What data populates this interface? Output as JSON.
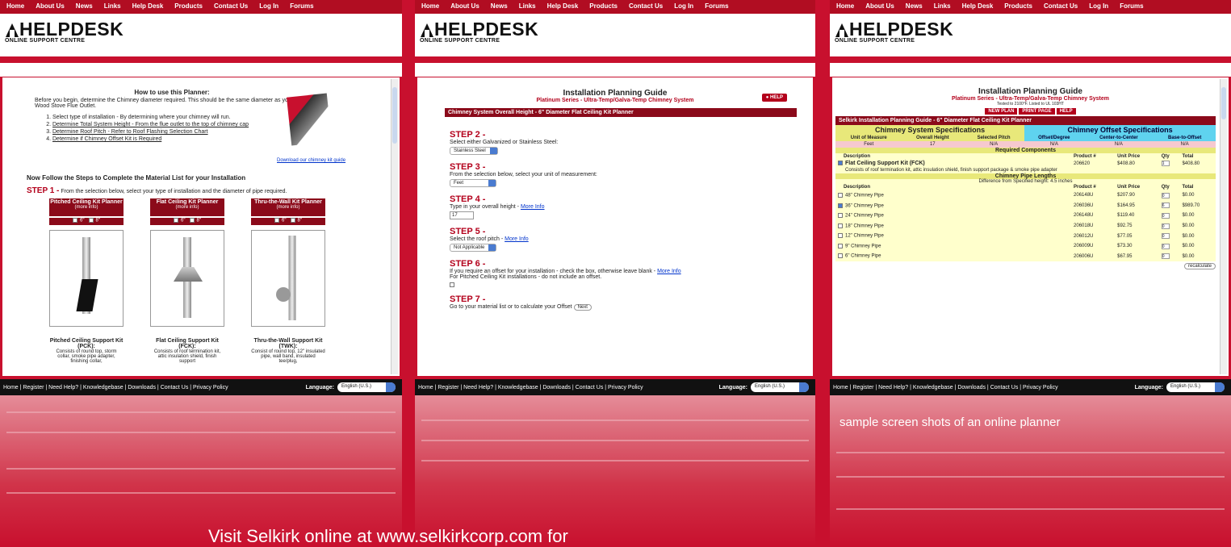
{
  "nav": [
    "Home",
    "About Us",
    "News",
    "Links",
    "Help Desk",
    "Products",
    "Contact Us",
    "Log In",
    "Forums"
  ],
  "logo": {
    "title": "HELPDESK",
    "subtitle": "ONLINE SUPPORT CENTRE"
  },
  "footer": {
    "links": "Home  |  Register  |  Need Help?  |  Knowledgebase  |  Downloads  |  Contact Us  |  Privacy Policy",
    "language_label": "Language:",
    "language_value": "English (U.S.)"
  },
  "panel1": {
    "title": "How to use this Planner:",
    "intro": "Before you begin, determine the Chimney diameter required. This should be the same diameter as your Wood Stove Flue Outlet.",
    "list": [
      "Select type of installation - By determining where your chimney will run.",
      "Determine Total System Height - From the flue outlet to the top of chimney cap",
      "Determine Roof Pitch - Refer to Roof Flashing Selection Chart",
      "Determine if Chimney Offset Kit is Required"
    ],
    "download": "Download our chimney kit guide",
    "steps_heading": "Now Follow the Steps to Complete the Material List for your Installation",
    "step1_label": "STEP 1 -",
    "step1_text": "From the selection below, select your type of installation and the diameter of pipe required.",
    "kits": [
      {
        "header": "Pitched Ceiling Kit Planner",
        "more": "(more info)",
        "name": "Pitched Ceiling Support Kit (PCK):",
        "desc": "Consists of round top, storm collar, smoke pipe adapter, finishing collar,"
      },
      {
        "header": "Flat Ceiling Kit Planner",
        "more": "(more info)",
        "name": "Flat Ceiling Support Kit (FCK):",
        "desc": "Consists of roof termination kit, attic insulation shield, finish support"
      },
      {
        "header": "Thru-the-Wall Kit Planner",
        "more": "(more info)",
        "name": "Thru-the-Wall Support Kit (TWK):",
        "desc": "Consist of round top, 12\" insulated pipe, wall band, insulated tee/plug,"
      }
    ],
    "size6": "6\"",
    "size8": "8\""
  },
  "panel2": {
    "title": "Installation Planning Guide",
    "subtitle": "Platinum Series - Ultra-Temp/Galva-Temp Chimney System",
    "help": "HELP",
    "bar": "Chimney System Overall Height - 6\" Diameter Flat Ceiling Kit Planner",
    "step2": "STEP 2 -",
    "step2_text": "Select either Galvanized or Stainless Steel:",
    "step2_val": "Stainless Steel",
    "step3": "STEP 3 -",
    "step3_text": "From the selection below, select your unit of measurement:",
    "step3_val": "Feet",
    "step4": "STEP 4 -",
    "step4_text": "Type in your overall height -",
    "step4_link": "More Info",
    "step4_val": "17",
    "step5": "STEP 5 -",
    "step5_text": "Select the roof pitch -",
    "step5_link": "More Info",
    "step5_val": "Not Applicable",
    "step6": "STEP 6 -",
    "step6_text": "If you require an offset for your installation - check the box, otherwise leave blank -",
    "step6_link": "More Info",
    "step6_text2": "For Pitched Ceiling Kit installations - do not include an offset.",
    "step7": "STEP 7 -",
    "step7_text": "Go to your material list or to calculate your Offset",
    "next": "Next"
  },
  "panel3": {
    "title": "Installation Planning Guide",
    "subtitle": "Platinum Series - Ultra-Temp/Galva-Temp Chimney System",
    "tested": "Tested to 2100°F.  Listed to UL 103HT",
    "buttons": [
      "NEW PLAN",
      "PRINT PAGE",
      "HELP"
    ],
    "bar": "Selkirk Installation Planning Guide - 6\" Diameter Flat Ceiling Kit Planner",
    "spec_left": "Chimney System Specifications",
    "spec_right": "Chimney Offset Specifications",
    "spec_cols": [
      "Unit of Measure",
      "Overall Height",
      "Selected Pitch",
      "Offset/Degree",
      "Center-to-Center",
      "Base-to-Offset"
    ],
    "spec_vals": [
      "Feet",
      "17",
      "N/A",
      "N/A",
      "N/A",
      "N/A"
    ],
    "required": "Required Components",
    "cols": [
      "Description",
      "Product #",
      "Unit Price",
      "Qty",
      "Total"
    ],
    "fck": {
      "desc": "Flat Ceiling Support Kit (FCK)",
      "pn": "206620",
      "price": "$408.80",
      "qty": "1",
      "total": "$408.80",
      "note": "Consists of roof termination kit, attic insulation shield, finish support package & smoke pipe adapter"
    },
    "lengths": "Chimney Pipe Lengths",
    "diff": "Difference from Specified height: 4.5 inches",
    "pipes": [
      {
        "d": "48\" Chimney Pipe",
        "pn": "206148U",
        "p": "$207.90",
        "q": "0",
        "t": "$0.00",
        "on": false
      },
      {
        "d": "36\" Chimney Pipe",
        "pn": "206036U",
        "p": "$164.95",
        "q": "6",
        "t": "$989.70",
        "on": true
      },
      {
        "d": "24\" Chimney Pipe",
        "pn": "206148U",
        "p": "$119.40",
        "q": "0",
        "t": "$0.00",
        "on": false
      },
      {
        "d": "18\" Chimney Pipe",
        "pn": "206018U",
        "p": "$92.75",
        "q": "0",
        "t": "$0.00",
        "on": false
      },
      {
        "d": "12\" Chimney Pipe",
        "pn": "206012U",
        "p": "$77.05",
        "q": "0",
        "t": "$0.00",
        "on": false
      },
      {
        "d": "9\" Chimney Pipe",
        "pn": "206009U",
        "p": "$73.30",
        "q": "0",
        "t": "$0.00",
        "on": false
      },
      {
        "d": "6\" Chimney Pipe",
        "pn": "206006U",
        "p": "$67.95",
        "q": "0",
        "t": "$0.00",
        "on": false
      }
    ],
    "recalc": "recalculate"
  },
  "caption_right": "sample screen shots of an online planner",
  "caption_bottom": "Visit Selkirk online at www.selkirkcorp.com for"
}
